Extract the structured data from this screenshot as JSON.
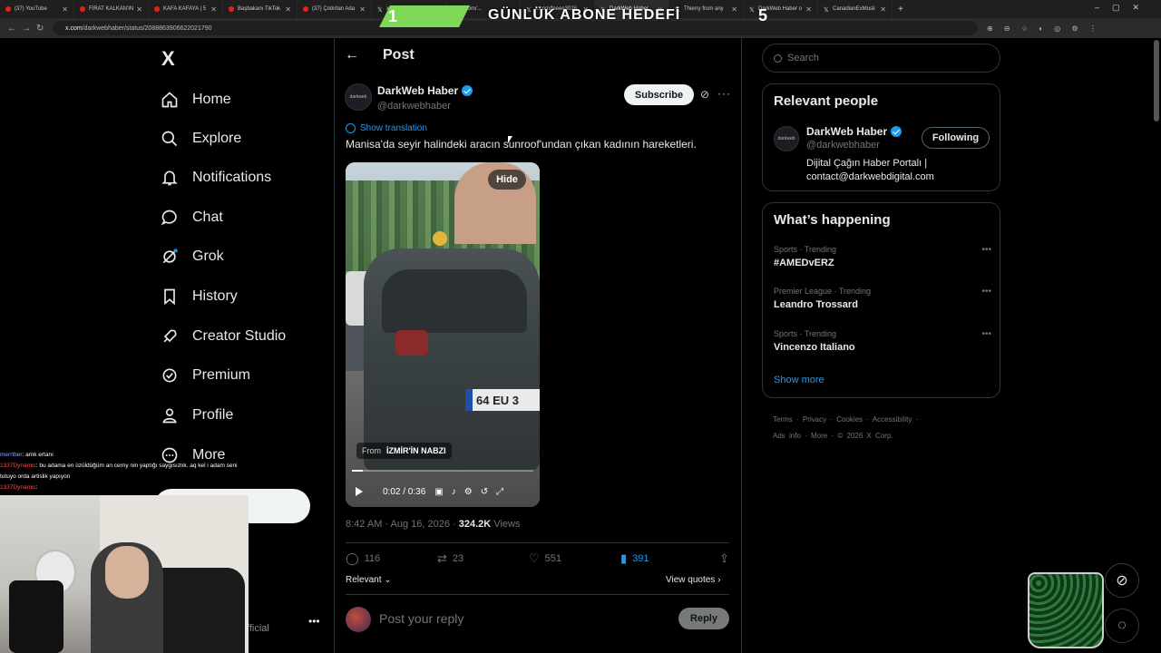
{
  "browser": {
    "tabs": [
      {
        "label": "(37) YouTube"
      },
      {
        "label": "FIRAT KALKAN'IN"
      },
      {
        "label": "KAFA KAFAYA | 5"
      },
      {
        "label": "Başbakanı TikTok"
      },
      {
        "label": "(37) Çıldırtan Ada"
      },
      {
        "label": "x.com/..."
      },
      {
        "label": "x.com/..."
      },
      {
        "label": "x.com/feeee3026"
      },
      {
        "label": "DarkWeb Haber"
      },
      {
        "label": "Thierry from any"
      },
      {
        "label": "DarkWeb Haber o"
      },
      {
        "label": "CanadianExMusli"
      }
    ],
    "url_domain": "x.com",
    "url_path": "/darkwebhaber/status/2088863906622021790"
  },
  "stream_overlay": {
    "goal_left": "1",
    "goal_title": "GÜNLÜK ABONE HEDEFİ",
    "goal_right": "5",
    "chat": [
      {
        "user": "merrtber",
        "text": ": amk ertanı"
      },
      {
        "user": "1337Dynamic",
        "text": ": bu adama en üzüldüğüm an cerny nin yaptığı saygısızlık. aq kel i adam seni tutuyo orda artislik yapıyon"
      },
      {
        "user": "1337Dynamic",
        "text": ":"
      }
    ],
    "colors": {
      "goal_green": "#7ed957"
    }
  },
  "leftnav": {
    "logo": "X",
    "items": [
      {
        "label": "Home",
        "icon": "home-icon"
      },
      {
        "label": "Explore",
        "icon": "search-icon"
      },
      {
        "label": "Notifications",
        "icon": "bell-icon"
      },
      {
        "label": "Chat",
        "icon": "chat-icon"
      },
      {
        "label": "Grok",
        "icon": "grok-icon"
      },
      {
        "label": "History",
        "icon": "bookmark-icon"
      },
      {
        "label": "Creator Studio",
        "icon": "rocket-icon"
      },
      {
        "label": "Premium",
        "icon": "verified-icon"
      },
      {
        "label": "Profile",
        "icon": "profile-icon"
      },
      {
        "label": "More",
        "icon": "more-icon"
      }
    ],
    "account_suffix": "fficial"
  },
  "post": {
    "header": "Post",
    "author_avatar_text": "darkweb",
    "author_name": "DarkWeb Haber",
    "author_handle": "@darkwebhaber",
    "subscribe_label": "Subscribe",
    "show_translation": "Show translation",
    "text": "Manisa'da seyir halindeki aracın sunroof'undan çıkan kadının hareketleri.",
    "video": {
      "hide_label": "Hide",
      "from_label": "From",
      "from_source": "İZMİR'İN NABZI",
      "time": "0:02 / 0:36",
      "progress": 0.06,
      "plate": "64 EU 3"
    },
    "timestamp": "8:42 AM · Aug 16, 2026",
    "views_count": "324.2K",
    "views_label": "Views",
    "stats": {
      "replies": "116",
      "reposts": "23",
      "likes": "551",
      "bookmarks": "391"
    },
    "relevant_label": "Relevant",
    "view_quotes_label": "View quotes",
    "reply_placeholder": "Post your reply",
    "reply_button": "Reply",
    "colors": {
      "accent": "#1d9bf0"
    }
  },
  "right": {
    "search_placeholder": "Search",
    "relevant_people": {
      "title": "Relevant people",
      "name": "DarkWeb Haber",
      "handle": "@darkwebhaber",
      "avatar_text": "darkweb",
      "following_label": "Following",
      "bio": "Dijital Çağın Haber Portalı | contact@darkwebdigital.com"
    },
    "whats_happening": {
      "title": "What’s happening",
      "trends": [
        {
          "category": "Sports · Trending",
          "topic": "#AMEDvERZ"
        },
        {
          "category": "Premier League · Trending",
          "topic": "Leandro Trossard"
        },
        {
          "category": "Sports · Trending",
          "topic": "Vincenzo Italiano"
        }
      ],
      "show_more": "Show more"
    },
    "footer": [
      "Terms",
      "Privacy",
      "Cookies",
      "Accessibility",
      "Ads info",
      "More",
      "© 2026 X Corp."
    ]
  }
}
